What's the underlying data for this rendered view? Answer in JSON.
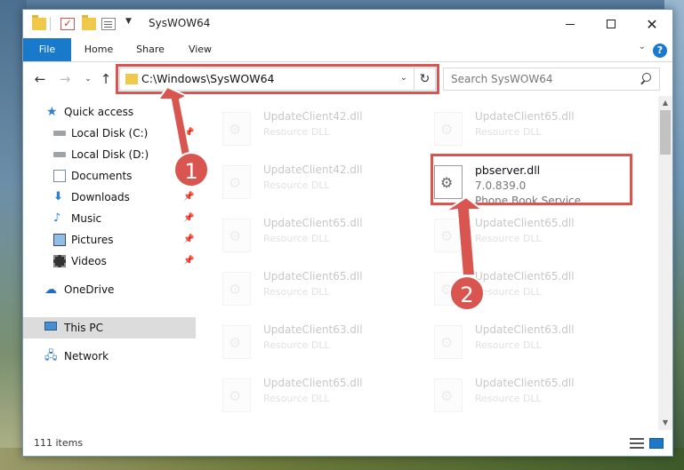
{
  "window": {
    "title": "SysWOW64"
  },
  "ribbon": {
    "tabs": [
      {
        "label": "File"
      },
      {
        "label": "Home"
      },
      {
        "label": "Share"
      },
      {
        "label": "View"
      }
    ],
    "help": "?"
  },
  "address": {
    "path": "C:\\Windows\\SysWOW64"
  },
  "search": {
    "placeholder": "Search SysWOW64"
  },
  "navpane": {
    "items": [
      {
        "label": "Quick access"
      },
      {
        "label": "Local Disk (C:)"
      },
      {
        "label": "Local Disk (D:)"
      },
      {
        "label": "Documents"
      },
      {
        "label": "Downloads"
      },
      {
        "label": "Music"
      },
      {
        "label": "Pictures"
      },
      {
        "label": "Videos"
      },
      {
        "label": "OneDrive"
      },
      {
        "label": "This PC"
      },
      {
        "label": "Network"
      }
    ]
  },
  "files": {
    "left": [
      {
        "name": "UpdateClient42.dll",
        "desc": "Resource DLL"
      },
      {
        "name": "UpdateClient42.dll",
        "desc": "Resource DLL"
      },
      {
        "name": "UpdateClient65.dll",
        "desc": "Resource DLL"
      },
      {
        "name": "UpdateClient65.dll",
        "desc": "Resource DLL"
      },
      {
        "name": "UpdateClient63.dll",
        "desc": "Resource DLL"
      },
      {
        "name": "UpdateClient65.dll",
        "desc": "Resource DLL"
      }
    ],
    "right": [
      {
        "name": "UpdateClient65.dll",
        "desc": "Resource DLL"
      },
      {
        "name": "UpdateClient65.dll",
        "desc": "Resource DLL"
      },
      {
        "name": "UpdateClient65.dll",
        "desc": "Resource DLL"
      },
      {
        "name": "UpdateClient63.dll",
        "desc": "Resource DLL"
      },
      {
        "name": "UpdateClient65.dll",
        "desc": "Resource DLL"
      }
    ],
    "selected": {
      "name": "pbserver.dll",
      "version": "7.0.839.0",
      "desc": "Phone Book Service"
    }
  },
  "status": {
    "item_count": "111 items"
  },
  "callouts": {
    "one": "1",
    "two": "2",
    "color": "#d8564f"
  },
  "colors": {
    "accent": "#1979ca",
    "highlight": "#d8564f"
  }
}
